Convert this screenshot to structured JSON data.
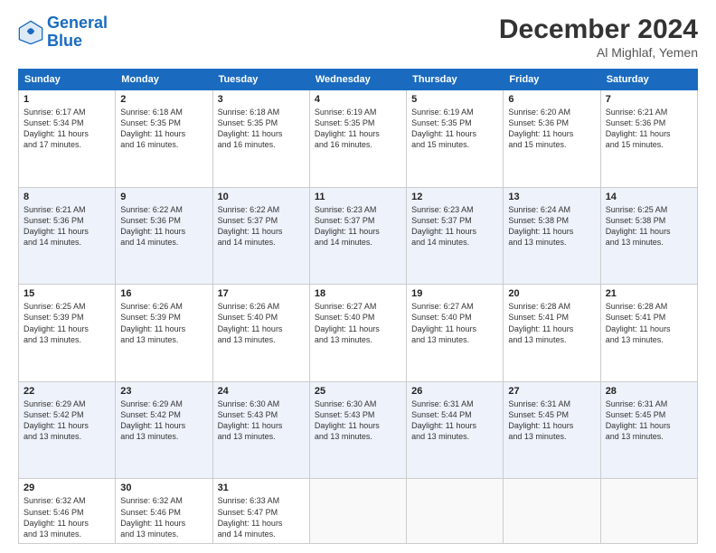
{
  "header": {
    "logo_line1": "General",
    "logo_line2": "Blue",
    "month": "December 2024",
    "location": "Al Mighlaf, Yemen"
  },
  "weekdays": [
    "Sunday",
    "Monday",
    "Tuesday",
    "Wednesday",
    "Thursday",
    "Friday",
    "Saturday"
  ],
  "weeks": [
    [
      {
        "day": "1",
        "lines": [
          "Sunrise: 6:17 AM",
          "Sunset: 5:34 PM",
          "Daylight: 11 hours",
          "and 17 minutes."
        ]
      },
      {
        "day": "2",
        "lines": [
          "Sunrise: 6:18 AM",
          "Sunset: 5:35 PM",
          "Daylight: 11 hours",
          "and 16 minutes."
        ]
      },
      {
        "day": "3",
        "lines": [
          "Sunrise: 6:18 AM",
          "Sunset: 5:35 PM",
          "Daylight: 11 hours",
          "and 16 minutes."
        ]
      },
      {
        "day": "4",
        "lines": [
          "Sunrise: 6:19 AM",
          "Sunset: 5:35 PM",
          "Daylight: 11 hours",
          "and 16 minutes."
        ]
      },
      {
        "day": "5",
        "lines": [
          "Sunrise: 6:19 AM",
          "Sunset: 5:35 PM",
          "Daylight: 11 hours",
          "and 15 minutes."
        ]
      },
      {
        "day": "6",
        "lines": [
          "Sunrise: 6:20 AM",
          "Sunset: 5:36 PM",
          "Daylight: 11 hours",
          "and 15 minutes."
        ]
      },
      {
        "day": "7",
        "lines": [
          "Sunrise: 6:21 AM",
          "Sunset: 5:36 PM",
          "Daylight: 11 hours",
          "and 15 minutes."
        ]
      }
    ],
    [
      {
        "day": "8",
        "lines": [
          "Sunrise: 6:21 AM",
          "Sunset: 5:36 PM",
          "Daylight: 11 hours",
          "and 14 minutes."
        ]
      },
      {
        "day": "9",
        "lines": [
          "Sunrise: 6:22 AM",
          "Sunset: 5:36 PM",
          "Daylight: 11 hours",
          "and 14 minutes."
        ]
      },
      {
        "day": "10",
        "lines": [
          "Sunrise: 6:22 AM",
          "Sunset: 5:37 PM",
          "Daylight: 11 hours",
          "and 14 minutes."
        ]
      },
      {
        "day": "11",
        "lines": [
          "Sunrise: 6:23 AM",
          "Sunset: 5:37 PM",
          "Daylight: 11 hours",
          "and 14 minutes."
        ]
      },
      {
        "day": "12",
        "lines": [
          "Sunrise: 6:23 AM",
          "Sunset: 5:37 PM",
          "Daylight: 11 hours",
          "and 14 minutes."
        ]
      },
      {
        "day": "13",
        "lines": [
          "Sunrise: 6:24 AM",
          "Sunset: 5:38 PM",
          "Daylight: 11 hours",
          "and 13 minutes."
        ]
      },
      {
        "day": "14",
        "lines": [
          "Sunrise: 6:25 AM",
          "Sunset: 5:38 PM",
          "Daylight: 11 hours",
          "and 13 minutes."
        ]
      }
    ],
    [
      {
        "day": "15",
        "lines": [
          "Sunrise: 6:25 AM",
          "Sunset: 5:39 PM",
          "Daylight: 11 hours",
          "and 13 minutes."
        ]
      },
      {
        "day": "16",
        "lines": [
          "Sunrise: 6:26 AM",
          "Sunset: 5:39 PM",
          "Daylight: 11 hours",
          "and 13 minutes."
        ]
      },
      {
        "day": "17",
        "lines": [
          "Sunrise: 6:26 AM",
          "Sunset: 5:40 PM",
          "Daylight: 11 hours",
          "and 13 minutes."
        ]
      },
      {
        "day": "18",
        "lines": [
          "Sunrise: 6:27 AM",
          "Sunset: 5:40 PM",
          "Daylight: 11 hours",
          "and 13 minutes."
        ]
      },
      {
        "day": "19",
        "lines": [
          "Sunrise: 6:27 AM",
          "Sunset: 5:40 PM",
          "Daylight: 11 hours",
          "and 13 minutes."
        ]
      },
      {
        "day": "20",
        "lines": [
          "Sunrise: 6:28 AM",
          "Sunset: 5:41 PM",
          "Daylight: 11 hours",
          "and 13 minutes."
        ]
      },
      {
        "day": "21",
        "lines": [
          "Sunrise: 6:28 AM",
          "Sunset: 5:41 PM",
          "Daylight: 11 hours",
          "and 13 minutes."
        ]
      }
    ],
    [
      {
        "day": "22",
        "lines": [
          "Sunrise: 6:29 AM",
          "Sunset: 5:42 PM",
          "Daylight: 11 hours",
          "and 13 minutes."
        ]
      },
      {
        "day": "23",
        "lines": [
          "Sunrise: 6:29 AM",
          "Sunset: 5:42 PM",
          "Daylight: 11 hours",
          "and 13 minutes."
        ]
      },
      {
        "day": "24",
        "lines": [
          "Sunrise: 6:30 AM",
          "Sunset: 5:43 PM",
          "Daylight: 11 hours",
          "and 13 minutes."
        ]
      },
      {
        "day": "25",
        "lines": [
          "Sunrise: 6:30 AM",
          "Sunset: 5:43 PM",
          "Daylight: 11 hours",
          "and 13 minutes."
        ]
      },
      {
        "day": "26",
        "lines": [
          "Sunrise: 6:31 AM",
          "Sunset: 5:44 PM",
          "Daylight: 11 hours",
          "and 13 minutes."
        ]
      },
      {
        "day": "27",
        "lines": [
          "Sunrise: 6:31 AM",
          "Sunset: 5:45 PM",
          "Daylight: 11 hours",
          "and 13 minutes."
        ]
      },
      {
        "day": "28",
        "lines": [
          "Sunrise: 6:31 AM",
          "Sunset: 5:45 PM",
          "Daylight: 11 hours",
          "and 13 minutes."
        ]
      }
    ],
    [
      {
        "day": "29",
        "lines": [
          "Sunrise: 6:32 AM",
          "Sunset: 5:46 PM",
          "Daylight: 11 hours",
          "and 13 minutes."
        ]
      },
      {
        "day": "30",
        "lines": [
          "Sunrise: 6:32 AM",
          "Sunset: 5:46 PM",
          "Daylight: 11 hours",
          "and 13 minutes."
        ]
      },
      {
        "day": "31",
        "lines": [
          "Sunrise: 6:33 AM",
          "Sunset: 5:47 PM",
          "Daylight: 11 hours",
          "and 14 minutes."
        ]
      },
      {
        "day": "",
        "lines": []
      },
      {
        "day": "",
        "lines": []
      },
      {
        "day": "",
        "lines": []
      },
      {
        "day": "",
        "lines": []
      }
    ]
  ]
}
